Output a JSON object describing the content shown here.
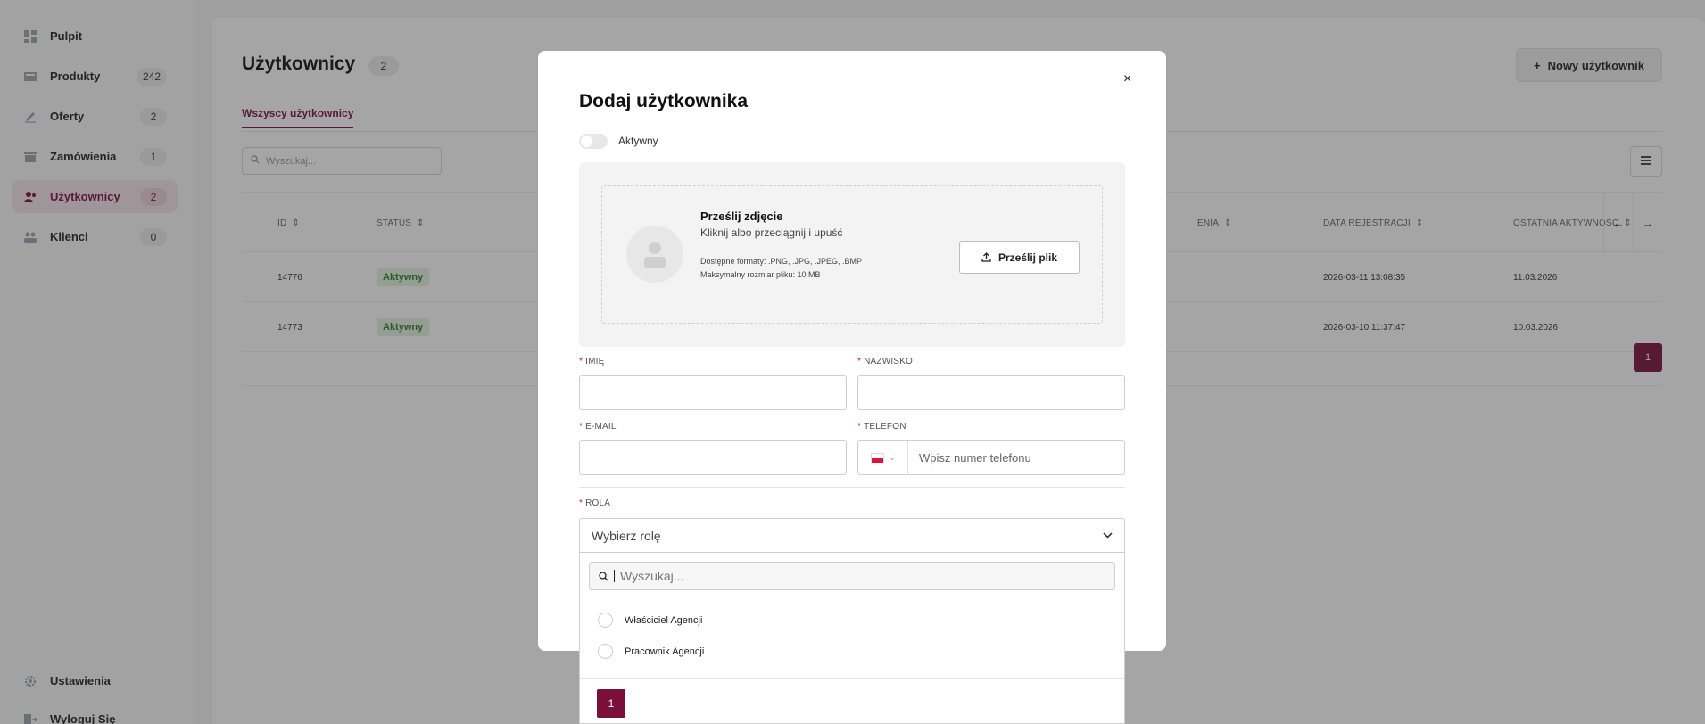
{
  "sidebar": {
    "items": [
      {
        "label": "Pulpit",
        "count": "",
        "icon": "dashboard-icon"
      },
      {
        "label": "Produkty",
        "count": "242",
        "icon": "box-icon"
      },
      {
        "label": "Oferty",
        "count": "2",
        "icon": "pencil-icon"
      },
      {
        "label": "Zamówienia",
        "count": "1",
        "icon": "archive-icon"
      },
      {
        "label": "Użytkownicy",
        "count": "2",
        "icon": "users-icon"
      },
      {
        "label": "Klienci",
        "count": "0",
        "icon": "clients-icon"
      }
    ],
    "bottom": [
      {
        "label": "Ustawienia",
        "icon": "gear-icon"
      },
      {
        "label": "Wyloguj Się",
        "icon": "logout-icon"
      }
    ]
  },
  "header": {
    "title": "Użytkownicy",
    "count": "2",
    "new_button": "Nowy użytkownik"
  },
  "tabs": {
    "all": "Wszyscy użytkownicy"
  },
  "search": {
    "placeholder": "Wyszukaj..."
  },
  "table": {
    "columns": [
      "ID",
      "STATUS",
      "ENIA",
      "DATA REJESTRACJI",
      "OSTATNIA AKTYWNOŚĆ"
    ],
    "rows": [
      {
        "id": "14776",
        "status": "Aktywny",
        "registered": "2026-03-11 13:08:35",
        "last_active": "11.03.2026"
      },
      {
        "id": "14773",
        "status": "Aktywny",
        "registered": "2026-03-10 11:37:47",
        "last_active": "10.03.2026"
      }
    ],
    "page": "1"
  },
  "modal": {
    "title": "Dodaj użytkownika",
    "close": "×",
    "toggle_label": "Aktywny",
    "upload": {
      "title": "Prześlij zdjęcie",
      "subtitle": "Kliknij albo przeciągnij i upuść",
      "formats": "Dostępne formaty: .PNG, .JPG, .JPEG, .BMP",
      "max_size": "Maksymalny rozmiar pliku: 10 MB",
      "button": "Prześlij plik"
    },
    "fields": {
      "first_name": "IMIĘ",
      "last_name": "NAZWISKO",
      "email": "E-MAIL",
      "phone": "TELEFON",
      "phone_placeholder": "Wpisz numer telefonu",
      "role": "ROLA",
      "role_placeholder": "Wybierz rolę"
    },
    "dropdown": {
      "search_placeholder": "Wyszukaj...",
      "options": [
        "Właściciel Agencji",
        "Pracownik Agencji"
      ],
      "page": "1"
    }
  },
  "colors": {
    "accent": "#7a0f3a",
    "badge_bg": "#e4f3df",
    "badge_text": "#2f7a2f",
    "required": "#c0163f"
  }
}
